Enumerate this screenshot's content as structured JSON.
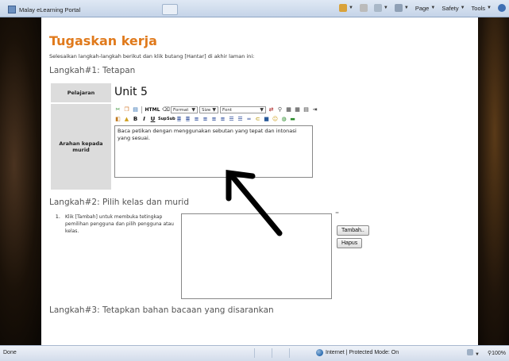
{
  "browser": {
    "tab_title": "Malay eLearning Portal",
    "commands": {
      "page": "Page",
      "safety": "Safety",
      "tools": "Tools"
    }
  },
  "page": {
    "title": "Tugaskan kerja",
    "instruction": "Selesaikan langkah-langkah berikut dan klik butang [Hantar] di akhir laman ini:",
    "step1": {
      "heading": "Langkah#1: Tetapan",
      "subject_label": "Pelajaran",
      "subject_value": "Unit 5",
      "instruction_label": "Arahan kepada murid",
      "editor": {
        "html_label": "HTML",
        "format_label": "Format",
        "size_label": "Size",
        "font_label": "Font",
        "content": "Baca petikan dengan menggunakan sebutan yang tepat dan intonasi yang sesuai."
      }
    },
    "step2": {
      "heading": "Langkah#2: Pilih kelas dan murid",
      "item_number": "1.",
      "item_text": "Klik [Tambah] untuk membuka tetingkap pemilihan pengguna dan pilih pengguna atau kelas.",
      "marker": "=",
      "add_button": "Tambah..",
      "remove_button": "Hapus"
    },
    "step3": {
      "heading": "Langkah#3: Tetapkan bahan bacaan yang disarankan"
    }
  },
  "statusbar": {
    "left": "Done",
    "zone": "Internet | Protected Mode: On",
    "zoom": "100%"
  },
  "colors": {
    "title_orange": "#e07a1c",
    "label_gray": "#dcdcdc"
  }
}
